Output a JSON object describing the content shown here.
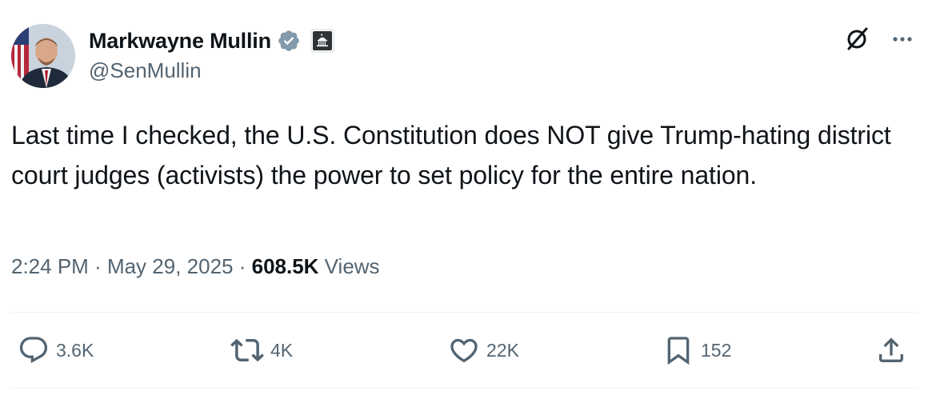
{
  "author": {
    "display_name": "Markwayne Mullin",
    "handle": "@SenMullin",
    "verified_icon": "verified-badge-icon",
    "affiliation_icon": "capitol-building-icon"
  },
  "header": {
    "grok_icon": "grok-icon",
    "more_icon": "more-horizontal-icon"
  },
  "tweet": {
    "text": "Last time I checked, the U.S. Constitution does NOT give Trump-hating district court judges (activists) the power to set policy for the entire nation."
  },
  "meta": {
    "time": "2:24 PM",
    "sep1": " · ",
    "date": "May 29, 2025",
    "sep2": " · ",
    "views_count": "608.5K",
    "views_label": " Views"
  },
  "actions": {
    "replies": "3.6K",
    "reposts": "4K",
    "likes": "22K",
    "bookmarks": "152",
    "share_icon": "share-icon"
  },
  "colors": {
    "text_primary": "#0f1419",
    "text_secondary": "#536471",
    "verified_blue": "#829aab",
    "divider": "#eff3f4"
  }
}
